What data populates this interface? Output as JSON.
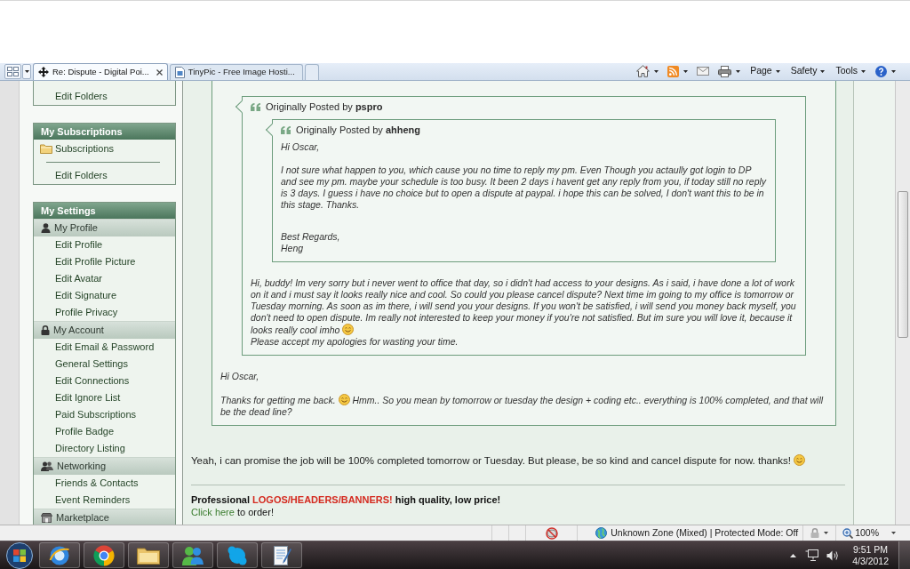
{
  "browser": {
    "tabs": [
      {
        "title": "Re: Dispute - Digital Poi...",
        "selected": true
      },
      {
        "title": "TinyPic - Free Image Hosti...",
        "selected": false
      }
    ],
    "menus": [
      "Page",
      "Safety",
      "Tools"
    ]
  },
  "sidebar": {
    "blocks": [
      {
        "items": [
          {
            "kind": "link",
            "label": "Edit Folders"
          }
        ]
      },
      {
        "title": "My Subscriptions",
        "items": [
          {
            "kind": "folder",
            "label": "Subscriptions"
          },
          {
            "kind": "divider"
          },
          {
            "kind": "link",
            "label": "Edit Folders"
          }
        ]
      },
      {
        "title": "My Settings",
        "groups": [
          {
            "kind": "profile",
            "title": "My Profile",
            "items": [
              "Edit Profile",
              "Edit Profile Picture",
              "Edit Avatar",
              "Edit Signature",
              "Profile Privacy"
            ]
          },
          {
            "kind": "account",
            "title": "My Account",
            "items": [
              "Edit Email & Password",
              "General Settings",
              "Edit Connections",
              "Edit Ignore List",
              "Paid Subscriptions",
              "Profile Badge",
              "Directory Listing"
            ]
          },
          {
            "kind": "networking",
            "title": "Networking",
            "items": [
              "Friends & Contacts",
              "Event Reminders"
            ]
          },
          {
            "kind": "marketplace",
            "title": "Marketplace"
          }
        ]
      }
    ]
  },
  "post": {
    "quote": {
      "quote": {
        "header": "Originally Posted by **pspro**",
        "quote": {
          "header": "Originally Posted by **ahheng**",
          "paragraphs": [
            [
              {
                "kind": "text",
                "text": "Hi Oscar,"
              }
            ],
            [
              {
                "kind": "text",
                "text": "I not sure what happen to you, which cause you no time to reply my pm. Even Though you actaully got login to DP and see my pm. maybe your schedule is too busy. It been 2 days i havent get any reply from you, if today still no reply is 3 days. I guess i have no choice but to open a dispute at paypal. i hope this can be solved, I don't want this to be in this stage. Thanks."
              }
            ]
          ],
          "signoff": [
            "Best Regards,",
            "Heng"
          ]
        },
        "paragraphs": [
          [
            {
              "kind": "text",
              "text": "Hi, buddy! Im very sorry but i never went to office that day, so i didn't had access to your designs. As i said, i have done a lot of work on it and i must say it looks really nice and cool. So could you please cancel dispute? Next time im going to my office is tomorrow or Tuesday morning. As soon as im there, i will send you your designs. If you won't be satisfied, i will send you money back myself, you don't need to open dispute. Im really not interested to keep your money if you're not satisfied. But im sure you will love it, because it looks really cool imho"
            },
            {
              "kind": "smiley"
            },
            {
              "kind": "break"
            },
            {
              "kind": "text",
              "text": "Please accept my apologies for wasting your time."
            }
          ]
        ]
      },
      "paragraphs": [
        [
          {
            "kind": "text",
            "text": "Hi Oscar,"
          }
        ],
        [
          {
            "kind": "text",
            "text": "Thanks for getting me back."
          },
          {
            "kind": "smiley"
          },
          {
            "kind": "text",
            "text": "Hmm.. So you mean by tomorrow or tuesday the design + coding etc.. everything is 100% completed, and that will be the dead line?"
          }
        ]
      ]
    },
    "message": [
      {
        "kind": "text",
        "text": "Yeah, i can promise the job will be 100% completed tomorrow or Tuesday. But please, be so kind and cancel dispute for now. thanks!"
      },
      {
        "kind": "smiley"
      }
    ],
    "signature": [
      [
        {
          "kind": "strong",
          "text": "Professional"
        },
        {
          "kind": "highlight",
          "text": "LOGOS/HEADERS/BANNERS!"
        },
        {
          "kind": "strong",
          "text": "high quality, low price!"
        }
      ],
      [
        {
          "kind": "link",
          "text": "Click here"
        },
        {
          "kind": "plain",
          "text": "to order!"
        }
      ]
    ]
  },
  "status_bar": {
    "zone": "Unknown Zone (Mixed) | Protected Mode: Off",
    "zoom": "100%"
  },
  "taskbar": {
    "time": "9:51 PM",
    "date": "4/3/2012"
  }
}
